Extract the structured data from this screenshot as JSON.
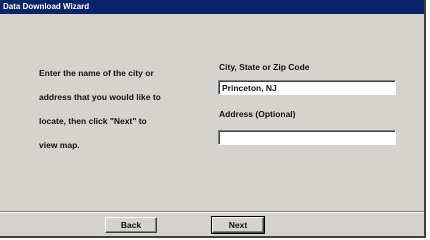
{
  "window": {
    "title": "Data Download Wizard"
  },
  "instructions": {
    "lines": [
      "Enter the name of the city or",
      "address that you would like to",
      "locate, then click \"Next\" to",
      "view map."
    ]
  },
  "form": {
    "city_label": "City, State or Zip Code",
    "city_value": "Princeton, NJ",
    "address_label": "Address (Optional)",
    "address_value": ""
  },
  "buttons": {
    "back_label": "Back",
    "next_label": "Next"
  }
}
